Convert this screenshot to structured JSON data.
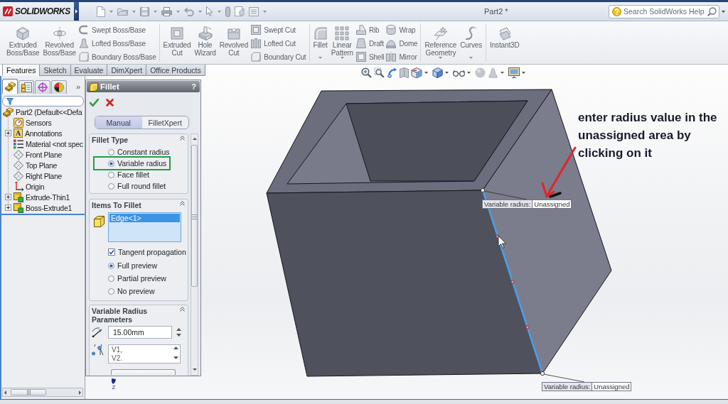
{
  "title_bar": {
    "logo": "SOLIDWORKS",
    "title": "Part2 *",
    "search": {
      "placeholder": "Search SolidWorks Help"
    }
  },
  "ribbon": {
    "groups": [
      {
        "items": [
          {
            "kind": "large",
            "label": "Extruded Boss/Base",
            "dropdown": false
          },
          {
            "kind": "large",
            "label": "Revolved Boss/Base",
            "dropdown": false
          },
          {
            "kind": "stack",
            "entries": [
              "Swept Boss/Base",
              "Lofted Boss/Base",
              "Boundary Boss/Base"
            ]
          }
        ]
      },
      {
        "items": [
          {
            "kind": "large",
            "label": "Extruded Cut",
            "dropdown": false
          },
          {
            "kind": "large",
            "label": "Hole Wizard",
            "dropdown": false
          },
          {
            "kind": "large",
            "label": "Revolved Cut",
            "dropdown": false
          },
          {
            "kind": "stack",
            "entries": [
              "Swept Cut",
              "Lofted Cut",
              "Boundary Cut"
            ]
          }
        ]
      },
      {
        "items": [
          {
            "kind": "large",
            "label": "Fillet",
            "dropdown": true
          },
          {
            "kind": "large",
            "label": "Linear Pattern",
            "dropdown": true
          },
          {
            "kind": "stack",
            "entries": [
              "Rib",
              "Draft",
              "Shell"
            ]
          },
          {
            "kind": "stack",
            "entries": [
              "Wrap",
              "Dome",
              "Mirror"
            ]
          }
        ]
      },
      {
        "items": [
          {
            "kind": "large",
            "label": "Reference Geometry",
            "dropdown": true
          },
          {
            "kind": "large",
            "label": "Curves",
            "dropdown": true
          }
        ]
      },
      {
        "items": [
          {
            "kind": "large",
            "label": "Instant3D",
            "dropdown": false
          }
        ]
      }
    ]
  },
  "tabs": [
    {
      "label": "Features",
      "selected": true
    },
    {
      "label": "Sketch",
      "selected": false
    },
    {
      "label": "Evaluate",
      "selected": false
    },
    {
      "label": "DimXpert",
      "selected": false
    },
    {
      "label": "Office Products",
      "selected": false
    }
  ],
  "feature_tree": {
    "panel_tabs": [
      {
        "kind": "tree",
        "selected": true
      },
      {
        "kind": "properties",
        "selected": false
      },
      {
        "kind": "target",
        "selected": false
      },
      {
        "kind": "appearance",
        "selected": false
      }
    ],
    "more": "»",
    "root": {
      "kind": "part",
      "label": "Part2 (Default<<Defa",
      "children": [
        {
          "kind": "sensors",
          "label": "Sensors",
          "expandable": false
        },
        {
          "kind": "annotations",
          "glyph": "A",
          "label": "Annotations",
          "expandable": true
        },
        {
          "kind": "material",
          "label": "Material <not spec",
          "expandable": false
        },
        {
          "kind": "plane",
          "label": "Front Plane",
          "expandable": false
        },
        {
          "kind": "plane",
          "label": "Top Plane",
          "expandable": false
        },
        {
          "kind": "plane",
          "label": "Right Plane",
          "expandable": false
        },
        {
          "kind": "origin",
          "label": "Origin",
          "expandable": false
        },
        {
          "kind": "feature",
          "label": "Extrude-Thin1",
          "expandable": true
        },
        {
          "kind": "feature",
          "label": "Boss-Extrude1",
          "expandable": true
        }
      ]
    }
  },
  "property_manager": {
    "title": "Fillet",
    "help": "?",
    "modes": [
      {
        "label": "Manual",
        "selected": true
      },
      {
        "label": "FilletXpert",
        "selected": false
      }
    ],
    "sections": [
      {
        "kind": "fillet_type",
        "title": "Fillet Type",
        "options": [
          {
            "label": "Constant radius",
            "selected": false,
            "highlighted": false
          },
          {
            "label": "Variable radius",
            "selected": true,
            "highlighted": true
          },
          {
            "label": "Face fillet",
            "selected": false,
            "highlighted": false
          },
          {
            "label": "Full round fillet",
            "selected": false,
            "highlighted": false
          }
        ]
      },
      {
        "kind": "items",
        "title": "Items To Fillet",
        "list": [
          {
            "label": "Edge<1>",
            "selected": true
          }
        ],
        "checkbox": {
          "label": "Tangent propagation",
          "checked": true
        },
        "options": [
          {
            "label": "Full preview",
            "selected": true
          },
          {
            "label": "Partial preview",
            "selected": false
          },
          {
            "label": "No preview",
            "selected": false
          }
        ]
      },
      {
        "kind": "variable",
        "title": "Variable Radius Parameters",
        "radius": {
          "value": "15.00mm"
        },
        "vertices": [
          "V1,",
          "V2."
        ]
      }
    ]
  },
  "viewport": {
    "note": "enter radius value in the unassigned area by clicking on it",
    "callouts": [
      {
        "label": "Variable radius:",
        "value": "Unassigned"
      },
      {
        "label": "Variable radius:",
        "value": "Unassigned"
      }
    ],
    "triad_axis": "Z"
  }
}
